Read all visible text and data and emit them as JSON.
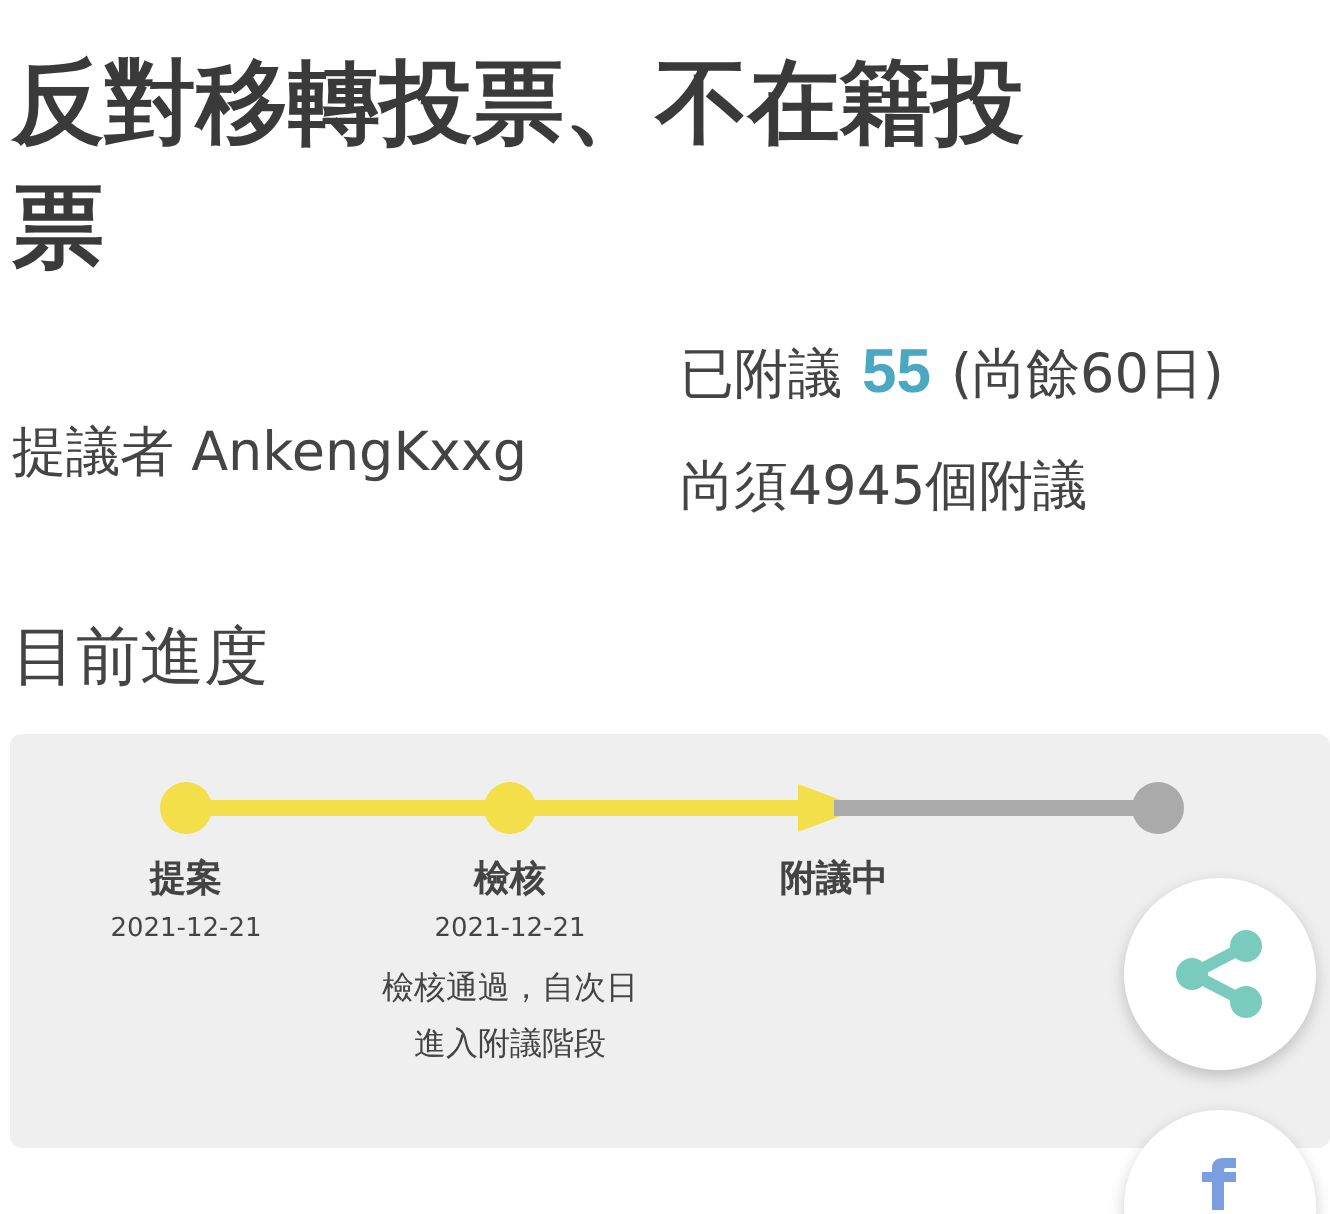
{
  "title": "反對移轉投票、不在籍投票",
  "proposer": {
    "label": "提議者",
    "name": "AnkengKxxg"
  },
  "endorsement": {
    "prefix": "已附議",
    "count": "55",
    "remaining": "(尚餘60日)",
    "needed": "尚須4945個附議"
  },
  "progress": {
    "heading": "目前進度",
    "steps": [
      {
        "done": true,
        "current": false,
        "label": "提案",
        "date": "2021-12-21"
      },
      {
        "done": true,
        "current": false,
        "label": "檢核",
        "date": "2021-12-21",
        "note": "檢核通過，自次日進入附議階段"
      },
      {
        "done": false,
        "current": true,
        "label": "附議中"
      },
      {
        "done": false,
        "current": false
      }
    ]
  }
}
